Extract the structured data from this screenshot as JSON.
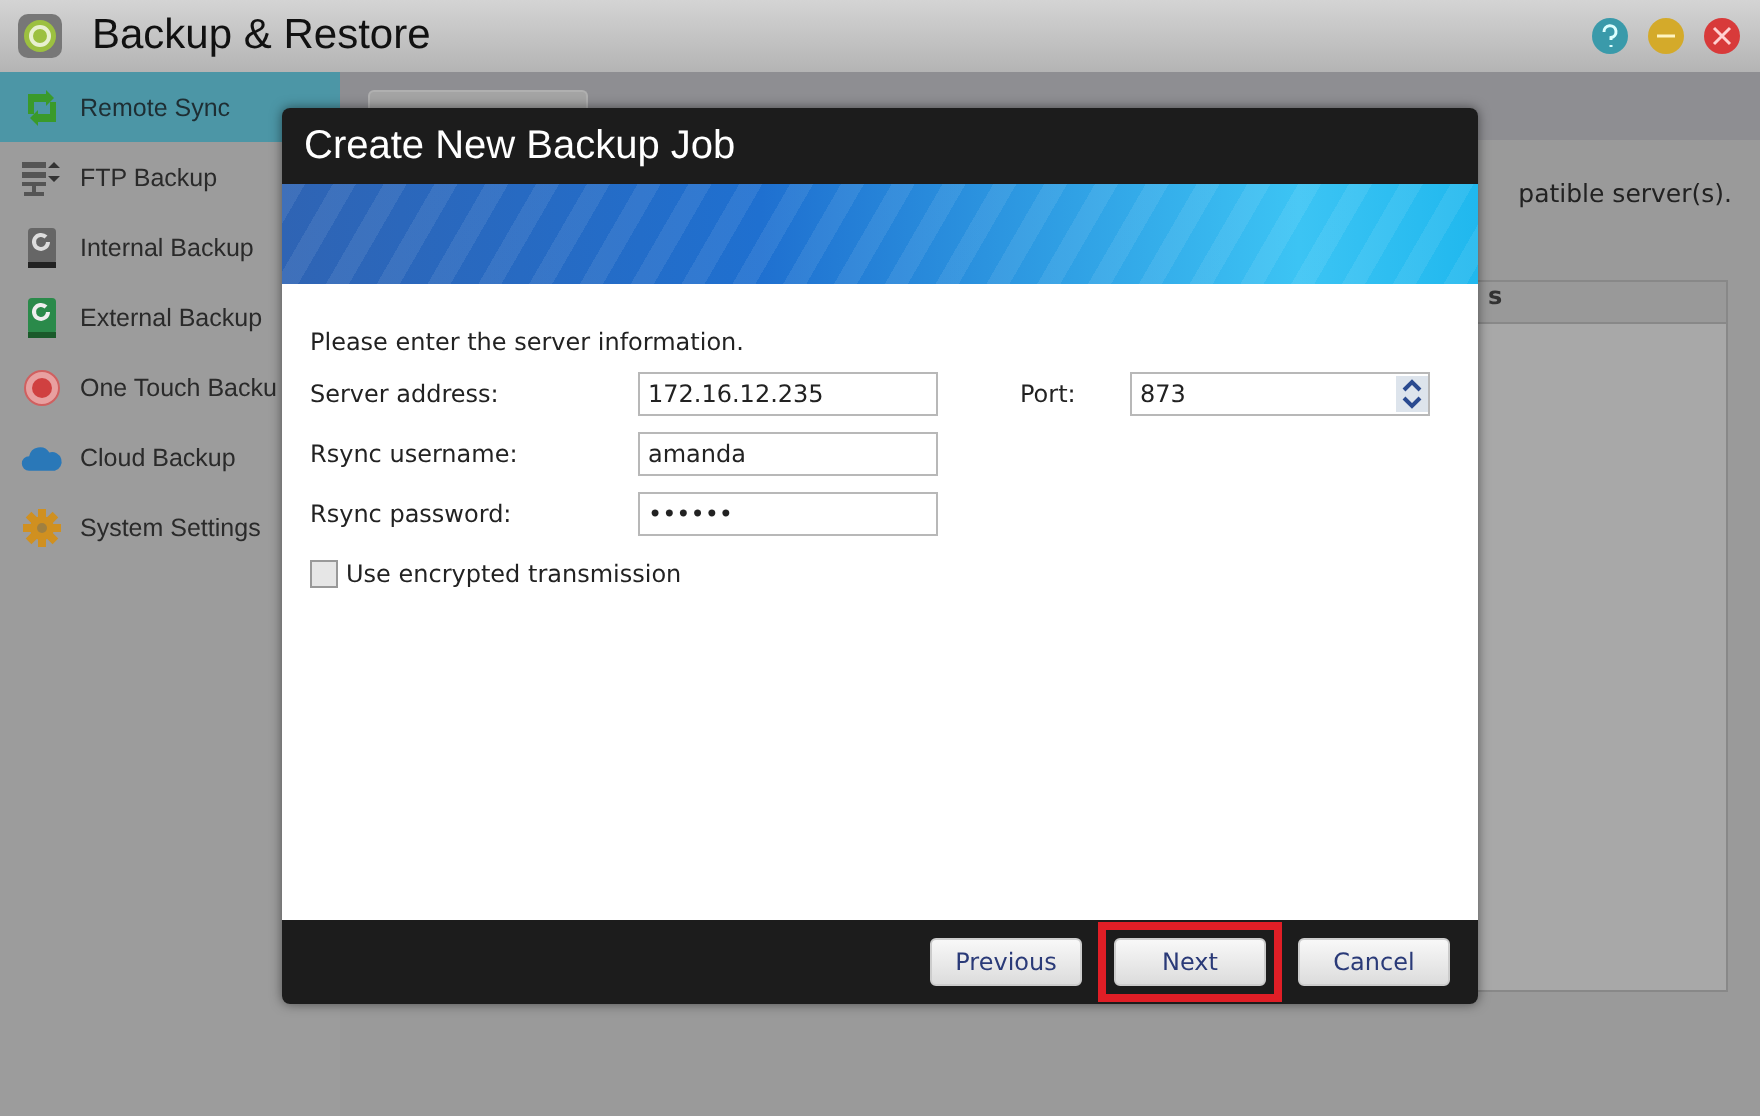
{
  "window": {
    "title": "Backup & Restore"
  },
  "sidebar": {
    "items": [
      {
        "label": "Remote Sync",
        "selected": true
      },
      {
        "label": "FTP Backup",
        "selected": false
      },
      {
        "label": "Internal Backup",
        "selected": false
      },
      {
        "label": "External Backup",
        "selected": false
      },
      {
        "label": "One Touch Backu",
        "selected": false
      },
      {
        "label": "Cloud Backup",
        "selected": false
      },
      {
        "label": "System Settings",
        "selected": false
      }
    ]
  },
  "main": {
    "description": "patible server(s).",
    "table": {
      "columns": [
        "s"
      ]
    }
  },
  "dialog": {
    "title": "Create New Backup Job",
    "instruction": "Please enter the server information.",
    "fields": [
      {
        "label": "Server address:",
        "value": "172.16.12.235"
      },
      {
        "label": "Rsync username:",
        "value": "amanda"
      },
      {
        "label": "Rsync password:",
        "value": "••••••"
      }
    ],
    "port": {
      "label": "Port:",
      "value": "873"
    },
    "checkbox": {
      "label": "Use encrypted transmission",
      "checked": false
    },
    "buttons": [
      {
        "label": "Previous",
        "highlighted": false
      },
      {
        "label": "Next",
        "highlighted": true
      },
      {
        "label": "Cancel",
        "highlighted": false
      }
    ]
  }
}
